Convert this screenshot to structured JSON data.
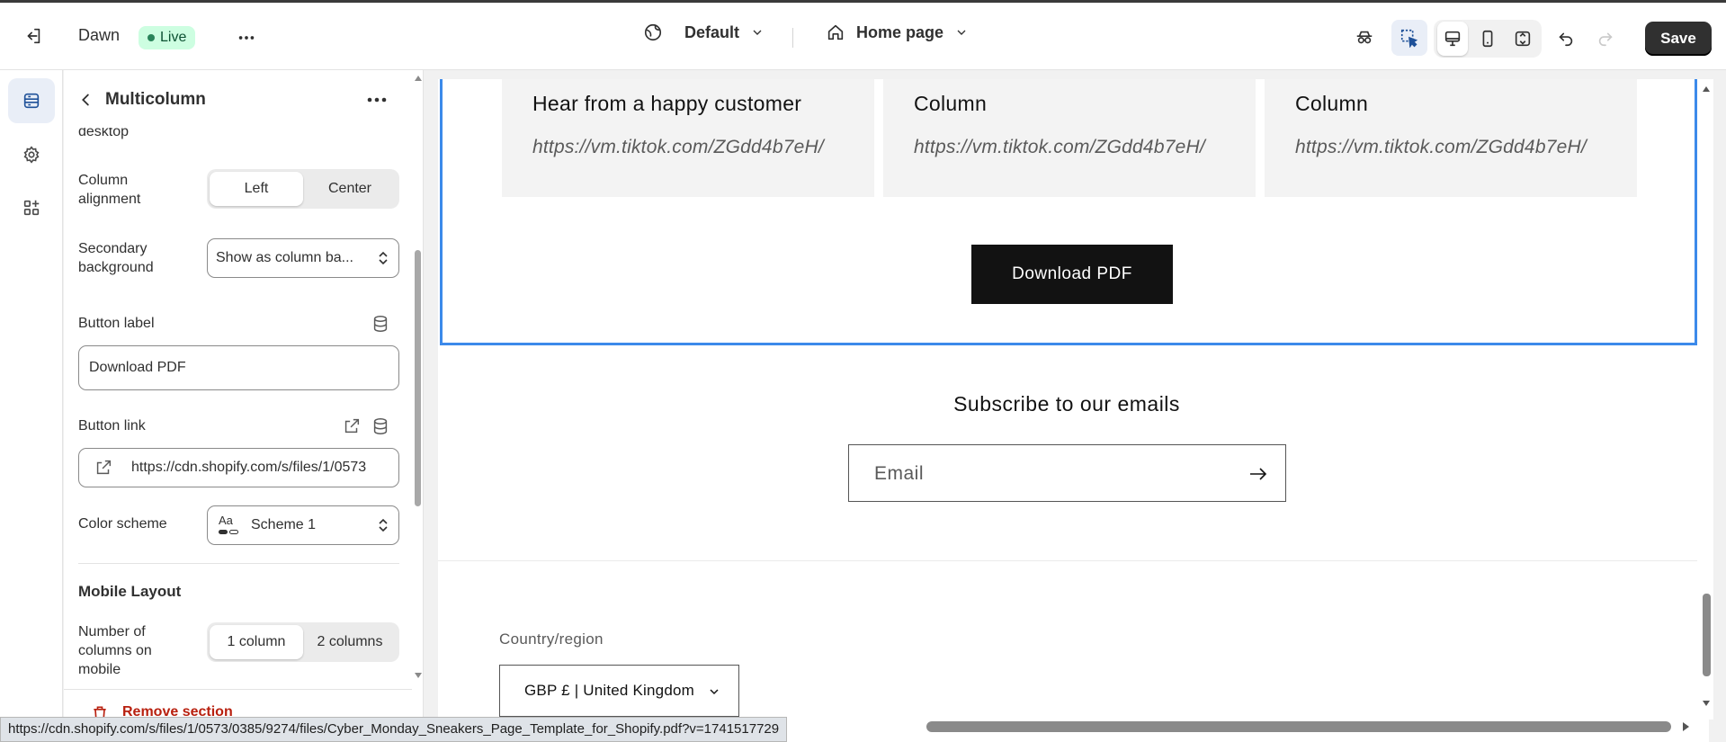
{
  "topbar": {
    "theme_name": "Dawn",
    "status_badge": "Live",
    "language": "Default",
    "page": "Home page",
    "save_label": "Save"
  },
  "rail": {
    "items": [
      "sections-icon",
      "settings-icon",
      "apps-icon"
    ]
  },
  "panel": {
    "title": "Multicolumn",
    "fragment": "desktop",
    "column_alignment": {
      "label": "Column alignment",
      "options": [
        "Left",
        "Center"
      ],
      "selected": "Left"
    },
    "secondary_background": {
      "label": "Secondary background",
      "value": "Show as column ba..."
    },
    "button_label": {
      "label": "Button label",
      "value": "Download PDF"
    },
    "button_link": {
      "label": "Button link",
      "value": "https://cdn.shopify.com/s/files/1/0573"
    },
    "color_scheme": {
      "label": "Color scheme",
      "value": "Scheme 1",
      "swatch": "Aa"
    },
    "mobile_layout": {
      "heading": "Mobile Layout",
      "columns_label": "Number of columns on mobile",
      "options": [
        "1 column",
        "2 columns"
      ],
      "selected": "1 column"
    },
    "remove_label": "Remove section"
  },
  "preview": {
    "columns": [
      {
        "title": "Hear from a happy customer",
        "link": "https://vm.tiktok.com/ZGdd4b7eH/"
      },
      {
        "title": "Column",
        "link": "https://vm.tiktok.com/ZGdd4b7eH/"
      },
      {
        "title": "Column",
        "link": "https://vm.tiktok.com/ZGdd4b7eH/"
      }
    ],
    "download_button": "Download PDF",
    "subscribe_title": "Subscribe to our emails",
    "email_placeholder": "Email",
    "country_label": "Country/region",
    "country_value": "GBP £ | United Kingdom"
  },
  "status_bar_url": "https://cdn.shopify.com/s/files/1/0573/0385/9274/files/Cyber_Monday_Sneakers_Page_Template_for_Shopify.pdf?v=1741517729",
  "colors": {
    "accent": "#3c8aea",
    "live_bg": "#cdfee1",
    "live_dot": "#29845a",
    "danger": "#b8200f",
    "button_dark": "#121212"
  }
}
